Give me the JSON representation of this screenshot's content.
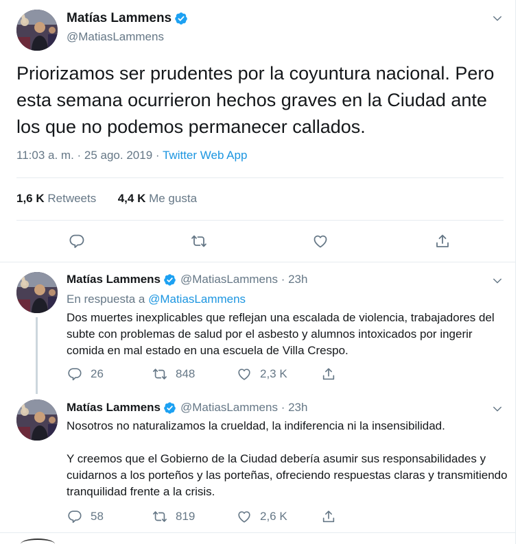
{
  "main_tweet": {
    "display_name": "Matías Lammens",
    "handle": "@MatiasLammens",
    "text": "Priorizamos ser prudentes por la coyuntura nacional. Pero esta semana ocurrieron hechos graves en la Ciudad ante los que no podemos permanecer callados.",
    "time": "11:03 a. m. · 25 ago. 2019 · ",
    "source": "Twitter Web App",
    "retweets_count": "1,6 K",
    "retweets_label": "Retweets",
    "likes_count": "4,4 K",
    "likes_label": "Me gusta"
  },
  "replies": [
    {
      "display_name": "Matías Lammens",
      "handle": "@MatiasLammens · 23h",
      "reply_prefix": "En respuesta a ",
      "reply_mention": "@MatiasLammens",
      "paragraphs": [
        "Dos muertes inexplicables que reflejan una escalada de violencia, trabajadores del subte con problemas de salud por el asbesto y alumnos intoxicados por ingerir comida en mal estado en una escuela de Villa Crespo."
      ],
      "reply_count": "26",
      "retweet_count": "848",
      "like_count": "2,3 K"
    },
    {
      "display_name": "Matías Lammens",
      "handle": "@MatiasLammens · 23h",
      "paragraphs": [
        "Nosotros no naturalizamos la crueldad, la indiferencia ni la insensibilidad.",
        "Y creemos que el Gobierno de la Ciudad debería asumir sus responsabilidades y cuidarnos a los porteños y las porteñas, ofreciendo respuestas claras y transmitiendo tranquilidad frente a la crisis."
      ],
      "reply_count": "58",
      "retweet_count": "819",
      "like_count": "2,6 K"
    }
  ],
  "colors": {
    "accent": "#1b95e0",
    "verified": "#1da1f2",
    "muted": "#657786",
    "text": "#14171a",
    "border": "#e6ecf0"
  },
  "icons": [
    "verified-badge-icon",
    "chevron-down-icon",
    "reply-icon",
    "retweet-icon",
    "like-icon",
    "share-icon"
  ]
}
